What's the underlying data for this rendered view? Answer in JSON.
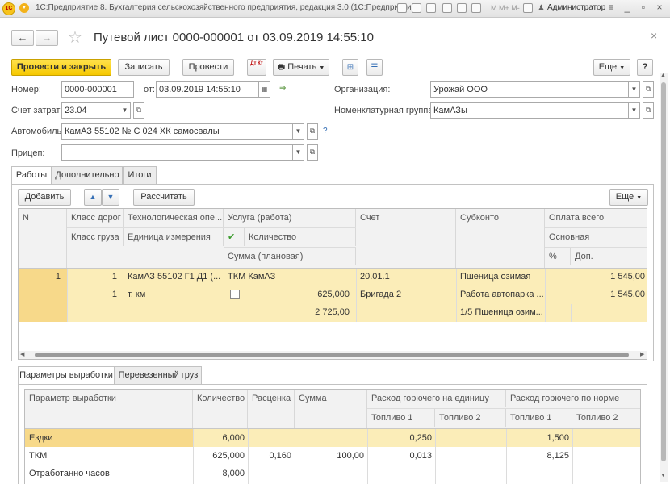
{
  "titlebar": {
    "logo": "1С",
    "caption": "1С:Предприятие 8. Бухгалтерия сельскохозяйственного предприятия, редакция 3.0 (1С:Предприятие)",
    "user": "Администратор"
  },
  "header": {
    "title": "Путевой лист 0000-000001 от 03.09.2019 14:55:10",
    "back_icon": "←",
    "forward_icon": "→",
    "star_icon": "☆"
  },
  "toolbar": {
    "post_close": "Провести и закрыть",
    "save": "Записать",
    "post": "Провести",
    "dtkt_icon": "Дт Кт",
    "print": "Печать",
    "more": "Еще",
    "help": "?"
  },
  "form": {
    "number_label": "Номер:",
    "number_value": "0000-000001",
    "date_label": "от:",
    "date_value": "03.09.2019 14:55:10",
    "account_label": "Счет затрат:",
    "account_value": "23.04",
    "vehicle_label": "Автомобиль:",
    "vehicle_value": "КамАЗ 55102 № С 024 ХК самосвалы",
    "vehicle_help": "?",
    "trailer_label": "Прицеп:",
    "trailer_value": "",
    "org_label": "Организация:",
    "org_value": "Урожай ООО",
    "nomgroup_label": "Номенклатурная группа:",
    "nomgroup_value": "КамАЗы"
  },
  "tabs": [
    "Работы",
    "Дополнительно",
    "Итоги"
  ],
  "works": {
    "add": "Добавить",
    "up_icon": "▲",
    "down_icon": "▼",
    "calc": "Рассчитать",
    "more": "Еще",
    "headers": {
      "n": "N",
      "road_class": "Класс дорог",
      "cargo_class": "Класс груза",
      "tech_op": "Технологическая опе...",
      "unit": "Единица измерения",
      "service": "Услуга (работа)",
      "quantity": "Количество",
      "sum_plan": "Сумма (плановая)",
      "account": "Счет",
      "subconto": "Субконто",
      "pay_total": "Оплата всего",
      "main": "Основная",
      "pct": "%",
      "extra": "Доп."
    },
    "row": {
      "n": "1",
      "road_class": "1",
      "cargo_class": "1",
      "tech_op": "КамАЗ 55102 Г1 Д1 (...",
      "unit": "т. км",
      "service": "ТКМ КамАЗ",
      "quantity": "625,000",
      "sum_plan": "2 725,00",
      "account": "20.01.1",
      "brigade": "Бригада 2",
      "sub1": "Пшеница озимая",
      "sub2": "Работа автопарка ...",
      "sub3": "1/5 Пшеница озим...",
      "pay_total": "1 545,00",
      "main": "1 545,00"
    }
  },
  "bottom_tabs": [
    "Параметры выработки",
    "Перевезенный груз"
  ],
  "params": {
    "headers": {
      "param": "Параметр выработки",
      "qty": "Количество",
      "rate": "Расценка",
      "sum": "Сумма",
      "fuel_unit": "Расход горючего на единицу",
      "fuel_norm": "Расход горючего по норме",
      "fuel1": "Топливо 1",
      "fuel2": "Топливо 2",
      "fuel1b": "Топливо 1",
      "fuel2b": "Топливо 2"
    },
    "rows": [
      {
        "param": "Ездки",
        "qty": "6,000",
        "rate": "",
        "sum": "",
        "fu1": "0,250",
        "fu2": "",
        "fn1": "1,500",
        "fn2": ""
      },
      {
        "param": "ТКМ",
        "qty": "625,000",
        "rate": "0,160",
        "sum": "100,00",
        "fu1": "0,013",
        "fu2": "",
        "fn1": "8,125",
        "fn2": ""
      },
      {
        "param": "Отработанно часов",
        "qty": "8,000",
        "rate": "",
        "sum": "",
        "fu1": "",
        "fu2": "",
        "fn1": "",
        "fn2": ""
      }
    ]
  }
}
